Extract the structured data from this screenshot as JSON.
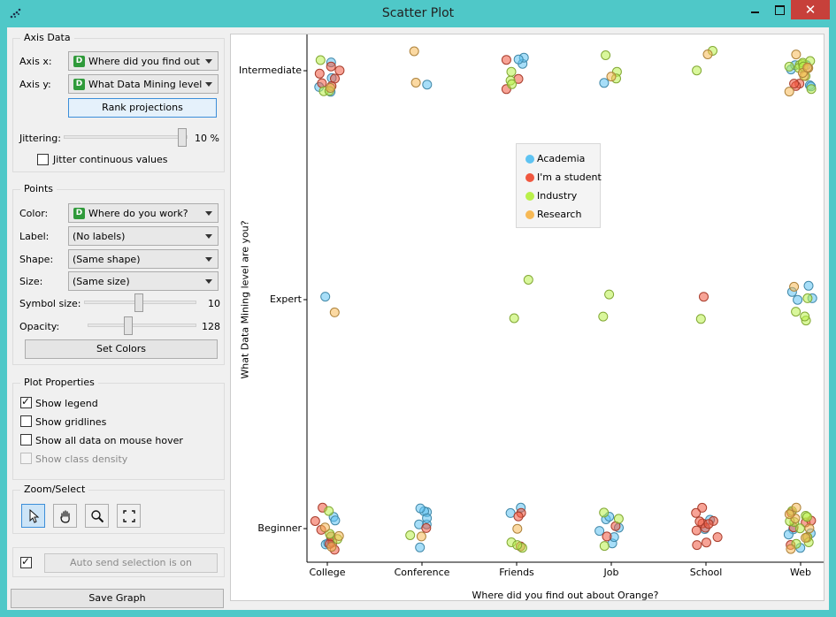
{
  "window": {
    "title": "Scatter Plot",
    "close_glyph": "✕",
    "minimize_icon": "minimize-icon",
    "maximize_icon": "maximize-icon"
  },
  "axis_data": {
    "title": "Axis Data",
    "axis_x_label": "Axis x:",
    "axis_x_value": "Where did you find out about Orange?",
    "axis_y_label": "Axis y:",
    "axis_y_value": "What Data Mining level are you?",
    "var_icon": "D",
    "rank_button": "Rank projections",
    "jittering_label": "Jittering:",
    "jittering_value": "10 %",
    "jitter_continuous": "Jitter continuous values"
  },
  "points": {
    "title": "Points",
    "color_label": "Color:",
    "color_value": "Where do you work?",
    "label_label": "Label:",
    "label_value": "(No labels)",
    "shape_label": "Shape:",
    "shape_value": "(Same shape)",
    "size_label": "Size:",
    "size_value": "(Same size)",
    "symbol_size_label": "Symbol size:",
    "symbol_size_value": "10",
    "opacity_label": "Opacity:",
    "opacity_value": "128",
    "set_colors": "Set Colors"
  },
  "plot_properties": {
    "title": "Plot Properties",
    "show_legend": "Show legend",
    "show_gridlines": "Show gridlines",
    "show_all_data": "Show all data on mouse hover",
    "show_class_density": "Show class density"
  },
  "zoom_select": {
    "title": "Zoom/Select",
    "tools": [
      "select-arrow-icon",
      "pan-hand-icon",
      "zoom-magnifier-icon",
      "zoom-reset-icon"
    ]
  },
  "auto_send": "Auto send selection is on",
  "save_graph": "Save Graph",
  "chart_data": {
    "type": "scatter",
    "xlabel": "Where did you find out about Orange?",
    "ylabel": "What Data Mining level are you?",
    "x_categories": [
      "College",
      "Conference",
      "Friends",
      "Job",
      "School",
      "Web"
    ],
    "y_categories": [
      "Beginner",
      "Expert",
      "Intermediate"
    ],
    "jitter": "10 %",
    "grid": false,
    "legend_position": "center",
    "legend": [
      {
        "name": "Academia",
        "color": "#5ec3f2"
      },
      {
        "name": "I'm a student",
        "color": "#f0573f"
      },
      {
        "name": "Industry",
        "color": "#b9f04a"
      },
      {
        "name": "Research",
        "color": "#f7b955"
      }
    ],
    "series": [
      {
        "name": "Academia",
        "color": "#5ec3f2",
        "points": [
          [
            "College",
            "Intermediate",
            4
          ],
          [
            "Conference",
            "Intermediate",
            1
          ],
          [
            "Friends",
            "Intermediate",
            3
          ],
          [
            "Job",
            "Intermediate",
            1
          ],
          [
            "Web",
            "Intermediate",
            5
          ],
          [
            "College",
            "Expert",
            1
          ],
          [
            "Web",
            "Expert",
            4
          ],
          [
            "College",
            "Beginner",
            4
          ],
          [
            "Conference",
            "Beginner",
            7
          ],
          [
            "Friends",
            "Beginner",
            2
          ],
          [
            "Job",
            "Beginner",
            6
          ],
          [
            "School",
            "Beginner",
            2
          ],
          [
            "Web",
            "Beginner",
            4
          ]
        ]
      },
      {
        "name": "I'm a student",
        "color": "#f0573f",
        "points": [
          [
            "College",
            "Intermediate",
            6
          ],
          [
            "Friends",
            "Intermediate",
            3
          ],
          [
            "Web",
            "Intermediate",
            3
          ],
          [
            "School",
            "Expert",
            1
          ],
          [
            "College",
            "Beginner",
            7
          ],
          [
            "Conference",
            "Beginner",
            1
          ],
          [
            "Friends",
            "Beginner",
            3
          ],
          [
            "Job",
            "Beginner",
            2
          ],
          [
            "School",
            "Beginner",
            11
          ],
          [
            "Web",
            "Beginner",
            6
          ]
        ]
      },
      {
        "name": "Industry",
        "color": "#b9f04a",
        "points": [
          [
            "College",
            "Intermediate",
            3
          ],
          [
            "Friends",
            "Intermediate",
            3
          ],
          [
            "Job",
            "Intermediate",
            3
          ],
          [
            "School",
            "Intermediate",
            2
          ],
          [
            "Web",
            "Intermediate",
            9
          ],
          [
            "Friends",
            "Expert",
            2
          ],
          [
            "Job",
            "Expert",
            2
          ],
          [
            "School",
            "Expert",
            1
          ],
          [
            "Web",
            "Expert",
            4
          ],
          [
            "College",
            "Beginner",
            3
          ],
          [
            "Conference",
            "Beginner",
            1
          ],
          [
            "Friends",
            "Beginner",
            3
          ],
          [
            "Job",
            "Beginner",
            3
          ],
          [
            "Web",
            "Beginner",
            9
          ]
        ]
      },
      {
        "name": "Research",
        "color": "#f7b955",
        "points": [
          [
            "College",
            "Intermediate",
            1
          ],
          [
            "Conference",
            "Intermediate",
            2
          ],
          [
            "Job",
            "Intermediate",
            1
          ],
          [
            "School",
            "Intermediate",
            1
          ],
          [
            "Web",
            "Intermediate",
            6
          ],
          [
            "College",
            "Expert",
            1
          ],
          [
            "Web",
            "Expert",
            1
          ],
          [
            "College",
            "Beginner",
            3
          ],
          [
            "Conference",
            "Beginner",
            1
          ],
          [
            "Friends",
            "Beginner",
            1
          ],
          [
            "Web",
            "Beginner",
            6
          ]
        ]
      }
    ]
  }
}
